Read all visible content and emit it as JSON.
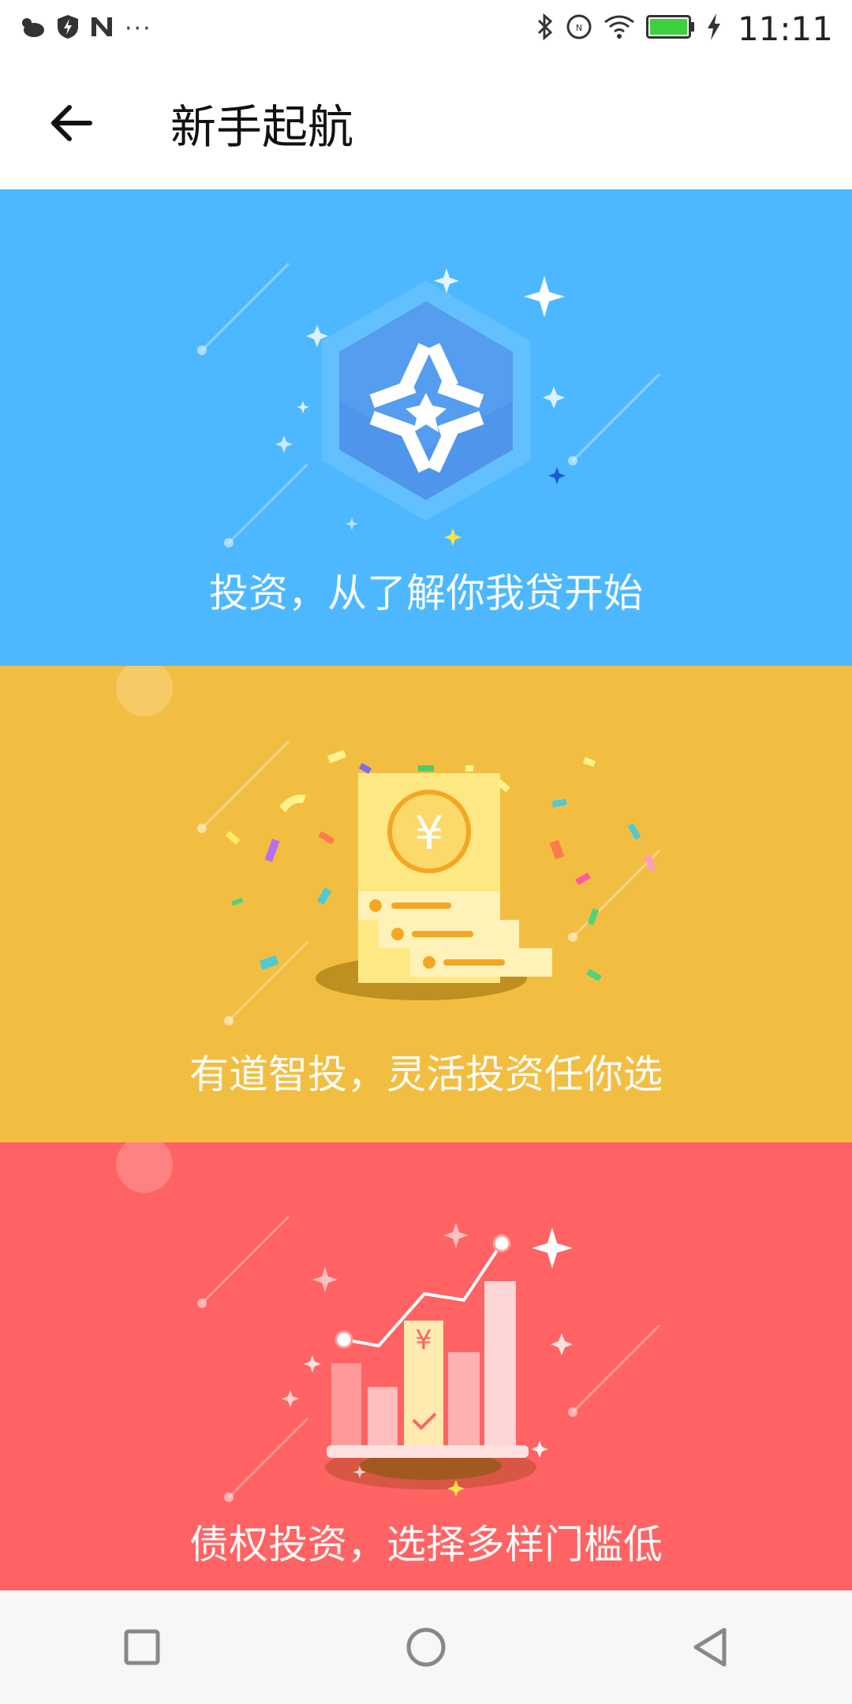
{
  "status_bar": {
    "time": "11:11",
    "left_icons": [
      "weather-cloud-icon",
      "shield-bolt-icon",
      "n-app-icon",
      "more-dots-icon"
    ],
    "more_indicator": "···",
    "right_icons": [
      "bluetooth-icon",
      "nfc-icon",
      "wifi-icon",
      "battery-icon",
      "charging-icon"
    ]
  },
  "header": {
    "title": "新手起航",
    "back_icon": "arrow-left-icon"
  },
  "cards": [
    {
      "caption": "投资，从了解你我贷开始",
      "color": "#4db8ff",
      "icon": "hexagon-logo-icon"
    },
    {
      "caption": "有道智投，灵活投资任你选",
      "color": "#f2be41",
      "icon": "yuan-card-icon"
    },
    {
      "caption": "债权投资，选择多样门槛低",
      "color": "#ff6363",
      "icon": "bar-chart-icon"
    }
  ],
  "nav_bar": {
    "icons": [
      "recent-apps-icon",
      "home-icon",
      "back-triangle-icon"
    ]
  }
}
